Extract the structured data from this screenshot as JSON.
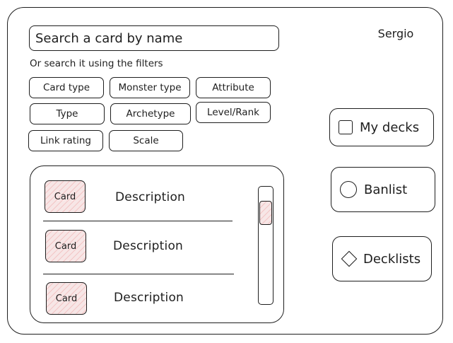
{
  "search": {
    "placeholder": "Search a card by name"
  },
  "user": {
    "name": "Sergio"
  },
  "filters": {
    "hint": "Or search it using the filters",
    "items": [
      "Card type",
      "Monster type",
      "Attribute",
      "Type",
      "Archetype",
      "Level/Rank",
      "Link rating",
      "Scale"
    ]
  },
  "nav": {
    "items": [
      {
        "label": "My decks",
        "icon": "square-icon"
      },
      {
        "label": "Banlist",
        "icon": "circle-icon"
      },
      {
        "label": "Decklists",
        "icon": "diamond-icon"
      }
    ]
  },
  "cards": {
    "rows": [
      {
        "thumb": "Card",
        "description": "Description"
      },
      {
        "thumb": "Card",
        "description": "Description"
      },
      {
        "thumb": "Card",
        "description": "Description"
      }
    ]
  },
  "colors": {
    "stroke": "#1e1e1e",
    "placeholder_fill": "#f7e6e6",
    "hatch": "#e03131"
  }
}
